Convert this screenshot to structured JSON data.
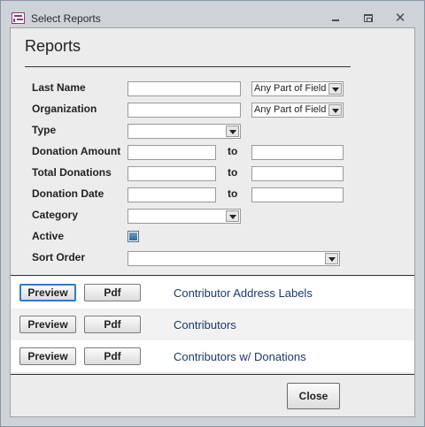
{
  "window": {
    "title": "Select Reports"
  },
  "form": {
    "heading": "Reports",
    "fields": {
      "last_name": {
        "label": "Last Name",
        "value": "",
        "match": "Any Part of Field"
      },
      "organization": {
        "label": "Organization",
        "value": "",
        "match": "Any Part of Field"
      },
      "type": {
        "label": "Type",
        "value": ""
      },
      "donation_amount": {
        "label": "Donation Amount",
        "from": "",
        "to_label": "to",
        "to": ""
      },
      "total_donations": {
        "label": "Total Donations",
        "from": "",
        "to_label": "to",
        "to": ""
      },
      "donation_date": {
        "label": "Donation Date",
        "from": "",
        "to_label": "to",
        "to": ""
      },
      "category": {
        "label": "Category",
        "value": ""
      },
      "active": {
        "label": "Active",
        "checked": true
      },
      "sort_order": {
        "label": "Sort Order",
        "value": ""
      }
    }
  },
  "reports": [
    {
      "preview_label": "Preview",
      "pdf_label": "Pdf",
      "name": "Contributor Address Labels"
    },
    {
      "preview_label": "Preview",
      "pdf_label": "Pdf",
      "name": "Contributors"
    },
    {
      "preview_label": "Preview",
      "pdf_label": "Pdf",
      "name": "Contributors w/ Donations"
    }
  ],
  "footer": {
    "close_label": "Close"
  },
  "icons": {
    "app": "form-icon",
    "minimize": "minimize-icon",
    "maximize": "maximize-icon",
    "close": "close-icon"
  },
  "colors": {
    "frame": "#ced3da",
    "panel": "#ececec",
    "report_text": "#1f3864",
    "focus": "#2e7ad0"
  }
}
